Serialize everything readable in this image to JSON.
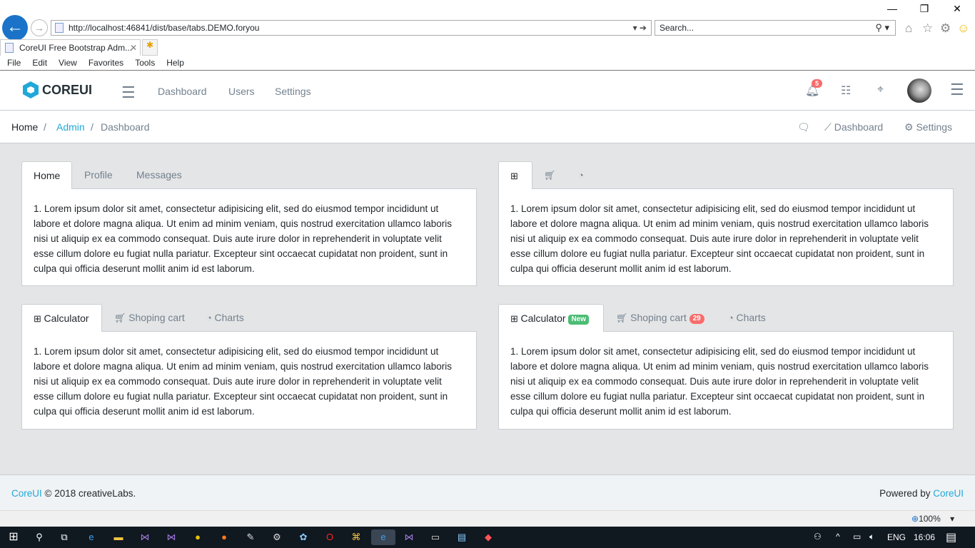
{
  "browser": {
    "url": "http://localhost:46841/dist/base/tabs.DEMO.foryou",
    "search_placeholder": "Search...",
    "tab_title": "CoreUI Free Bootstrap Adm...",
    "menu": [
      "File",
      "Edit",
      "View",
      "Favorites",
      "Tools",
      "Help"
    ],
    "zoom": "100%"
  },
  "header": {
    "brand": "COREUI",
    "nav": [
      "Dashboard",
      "Users",
      "Settings"
    ],
    "notification_count": "5"
  },
  "breadcrumb": {
    "items": [
      "Home",
      "Admin",
      "Dashboard"
    ],
    "right_menu": [
      "Dashboard",
      "Settings"
    ]
  },
  "cards": [
    {
      "tabs": [
        "Home",
        "Profile",
        "Messages"
      ]
    },
    {
      "tabs_icons": [
        "calculator-icon",
        "cart-icon",
        "pie-chart-icon"
      ]
    },
    {
      "tabs": [
        "Calculator",
        "Shoping cart",
        "Charts"
      ]
    },
    {
      "tabs": [
        "Calculator",
        "Shoping cart",
        "Charts"
      ],
      "badges": [
        "New",
        "29"
      ]
    }
  ],
  "content": "1. Lorem ipsum dolor sit amet, consectetur adipisicing elit, sed do eiusmod tempor incididunt ut labore et dolore magna aliqua. Ut enim ad minim veniam, quis nostrud exercitation ullamco laboris nisi ut aliquip ex ea commodo consequat. Duis aute irure dolor in reprehenderit in voluptate velit esse cillum dolore eu fugiat nulla pariatur. Excepteur sint occaecat cupidatat non proident, sunt in culpa qui officia deserunt mollit anim id est laborum.",
  "footer": {
    "brand": "CoreUI",
    "copyright": "© 2018 creativeLabs.",
    "powered": "Powered by",
    "powered_link": "CoreUI"
  },
  "taskbar": {
    "lang": "ENG",
    "time": "16:06"
  },
  "colors": {
    "primary": "#20a8d8",
    "success": "#4dbd74",
    "danger": "#f86c6b"
  }
}
